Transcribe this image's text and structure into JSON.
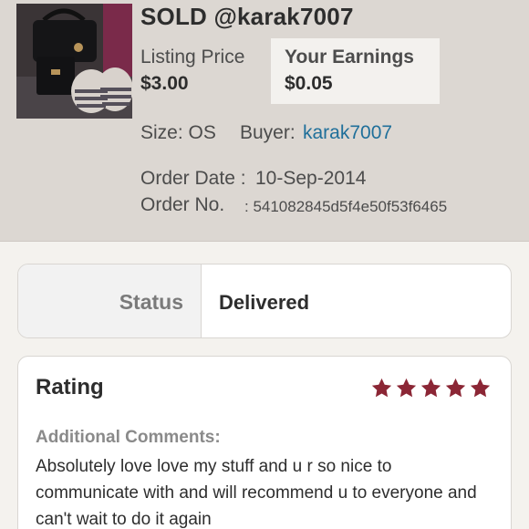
{
  "header": {
    "title": "SOLD @karak7007",
    "listing_price_label": "Listing Price",
    "listing_price": "$3.00",
    "earnings_label": "Your Earnings",
    "earnings": "$0.05",
    "size": "Size: OS",
    "buyer_label": "Buyer:",
    "buyer": "karak7007",
    "order_date_label": "Order Date :",
    "order_date": "10-Sep-2014",
    "order_no_label": "Order No.",
    "order_no": ": 541082845d5f4e50f53f6465"
  },
  "status": {
    "label": "Status",
    "value": "Delivered"
  },
  "rating": {
    "title": "Rating",
    "stars": 5,
    "star_color": "#8b2635",
    "comments_label": "Additional Comments:",
    "comments": "Absolutely love love my stuff and u r so nice to communicate with and will recommend u to everyone and can't wait to do it again"
  }
}
